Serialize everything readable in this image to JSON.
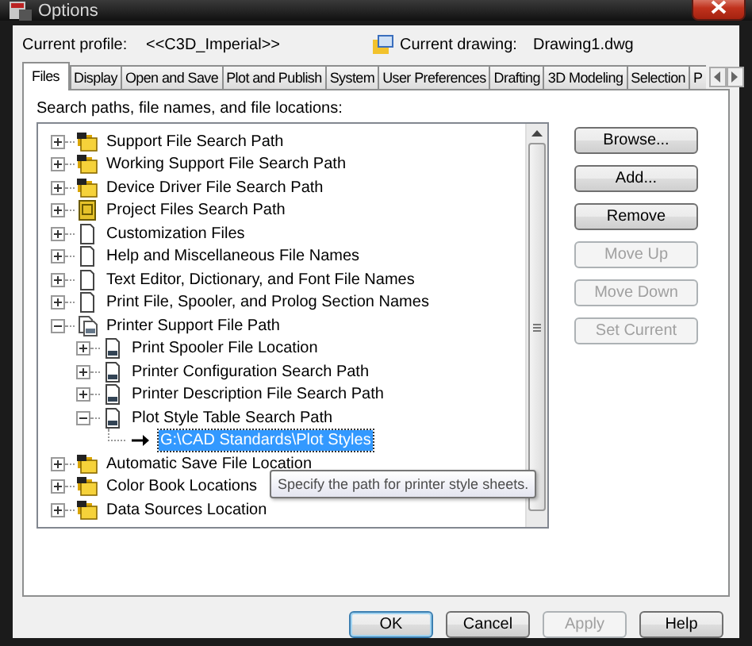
{
  "window": {
    "title": "Options"
  },
  "profile": {
    "label": "Current profile:",
    "value": "<<C3D_Imperial>>",
    "drawing_label": "Current drawing:",
    "drawing_value": "Drawing1.dwg"
  },
  "tabs": [
    {
      "label": "Files",
      "selected": true
    },
    {
      "label": "Display",
      "selected": false
    },
    {
      "label": "Open and Save",
      "selected": false
    },
    {
      "label": "Plot and Publish",
      "selected": false
    },
    {
      "label": "System",
      "selected": false
    },
    {
      "label": "User Preferences",
      "selected": false
    },
    {
      "label": "Drafting",
      "selected": false
    },
    {
      "label": "3D Modeling",
      "selected": false
    },
    {
      "label": "Selection",
      "selected": false
    },
    {
      "label": "P",
      "selected": false
    }
  ],
  "files": {
    "label": "Search paths, file names, and file locations:",
    "tree": [
      {
        "label": "Support File Search Path",
        "kind": "folders",
        "expanded": false,
        "selected": false
      },
      {
        "label": "Working Support File Search Path",
        "kind": "folders",
        "expanded": false,
        "selected": false
      },
      {
        "label": "Device Driver File Search Path",
        "kind": "folders",
        "expanded": false,
        "selected": false
      },
      {
        "label": "Project Files Search Path",
        "kind": "project",
        "expanded": false,
        "selected": false
      },
      {
        "label": "Customization Files",
        "kind": "file",
        "expanded": false,
        "selected": false
      },
      {
        "label": "Help and Miscellaneous File Names",
        "kind": "file",
        "expanded": false,
        "selected": false
      },
      {
        "label": "Text Editor, Dictionary, and Font File Names",
        "kind": "file",
        "expanded": false,
        "selected": false
      },
      {
        "label": "Print File, Spooler, and Prolog Section Names",
        "kind": "file",
        "expanded": false,
        "selected": false
      },
      {
        "label": "Printer Support File Path",
        "kind": "printer",
        "expanded": true,
        "selected": false,
        "children": [
          {
            "label": "Print Spooler File Location",
            "kind": "plot",
            "expanded": false,
            "selected": false
          },
          {
            "label": "Printer Configuration Search Path",
            "kind": "plot",
            "expanded": false,
            "selected": false
          },
          {
            "label": "Printer Description File Search Path",
            "kind": "plot",
            "expanded": false,
            "selected": false
          },
          {
            "label": "Plot Style Table Search Path",
            "kind": "plot",
            "expanded": true,
            "selected": false,
            "children": [
              {
                "label": "G:\\CAD Standards\\Plot Styles",
                "kind": "path",
                "selected": true
              }
            ]
          }
        ]
      },
      {
        "label": "Automatic Save File Location",
        "kind": "folders",
        "expanded": false,
        "selected": false
      },
      {
        "label": "Color Book Locations",
        "kind": "folders",
        "expanded": false,
        "selected": false
      },
      {
        "label": "Data Sources Location",
        "kind": "folders",
        "expanded": false,
        "selected": false
      }
    ],
    "tooltip": "Specify the path for printer style sheets.",
    "buttons": [
      {
        "label": "Browse...",
        "disabled": false
      },
      {
        "label": "Add...",
        "disabled": false
      },
      {
        "label": "Remove",
        "disabled": false
      },
      {
        "label": "Move Up",
        "disabled": true
      },
      {
        "label": "Move Down",
        "disabled": true
      },
      {
        "label": "Set Current",
        "disabled": true
      }
    ]
  },
  "footer_buttons": [
    {
      "label": "OK",
      "disabled": false,
      "default": true
    },
    {
      "label": "Cancel",
      "disabled": false,
      "default": false
    },
    {
      "label": "Apply",
      "disabled": true,
      "default": false
    },
    {
      "label": "Help",
      "disabled": false,
      "default": false
    }
  ]
}
